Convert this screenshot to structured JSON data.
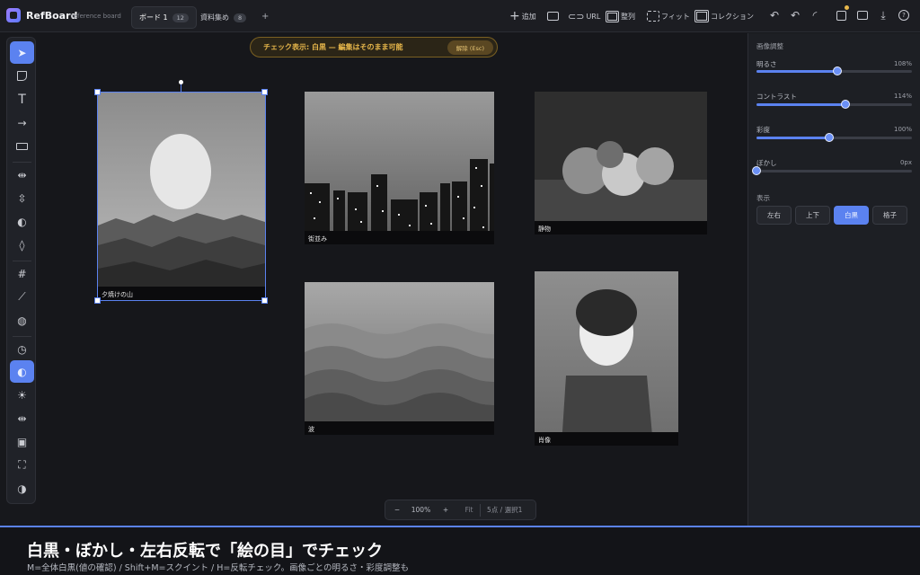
{
  "app": {
    "name": "RefBoard",
    "subtitle": "reference board"
  },
  "tabs": [
    {
      "label": "ボード 1",
      "count": "12",
      "active": true
    },
    {
      "label": "資料集め",
      "count": "8",
      "active": false
    }
  ],
  "toolbar": {
    "add": "追加",
    "url": "URL",
    "arrange": "整列",
    "fit": "フィット",
    "collection": "コレクション"
  },
  "banner": {
    "text": "チェック表示: 白黒 — 編集はそのまま可能",
    "button": "解除 (Esc)"
  },
  "images": [
    {
      "caption": "夕焼けの山"
    },
    {
      "caption": "街並み"
    },
    {
      "caption": "静物"
    },
    {
      "caption": "波"
    },
    {
      "caption": "肖像"
    }
  ],
  "zoom": {
    "minus": "−",
    "level": "100%",
    "plus": "+",
    "fit": "Fit",
    "status": "5点 / 選択1"
  },
  "panel": {
    "title": "画像調整",
    "sliders": [
      {
        "label": "明るさ",
        "value": "108%",
        "level": 0.52
      },
      {
        "label": "コントラスト",
        "value": "114%",
        "level": 0.57
      },
      {
        "label": "彩度",
        "value": "100%",
        "level": 0.47
      },
      {
        "label": "ぼかし",
        "value": "0px",
        "level": 0.0
      }
    ],
    "view_label": "表示",
    "view_buttons": [
      {
        "label": "左右",
        "active": false
      },
      {
        "label": "上下",
        "active": false
      },
      {
        "label": "白黒",
        "active": true
      },
      {
        "label": "格子",
        "active": false
      }
    ]
  },
  "caption": {
    "title": "白黒・ぼかし・左右反転で「絵の目」でチェック",
    "subtitle": "M=全体白黒(値の確認) / Shift+M=スクイント / H=反転チェック。画像ごとの明るさ・彩度調整も"
  },
  "colors": {
    "accent": "#5b82f0",
    "banner_text": "#e8b84b"
  }
}
